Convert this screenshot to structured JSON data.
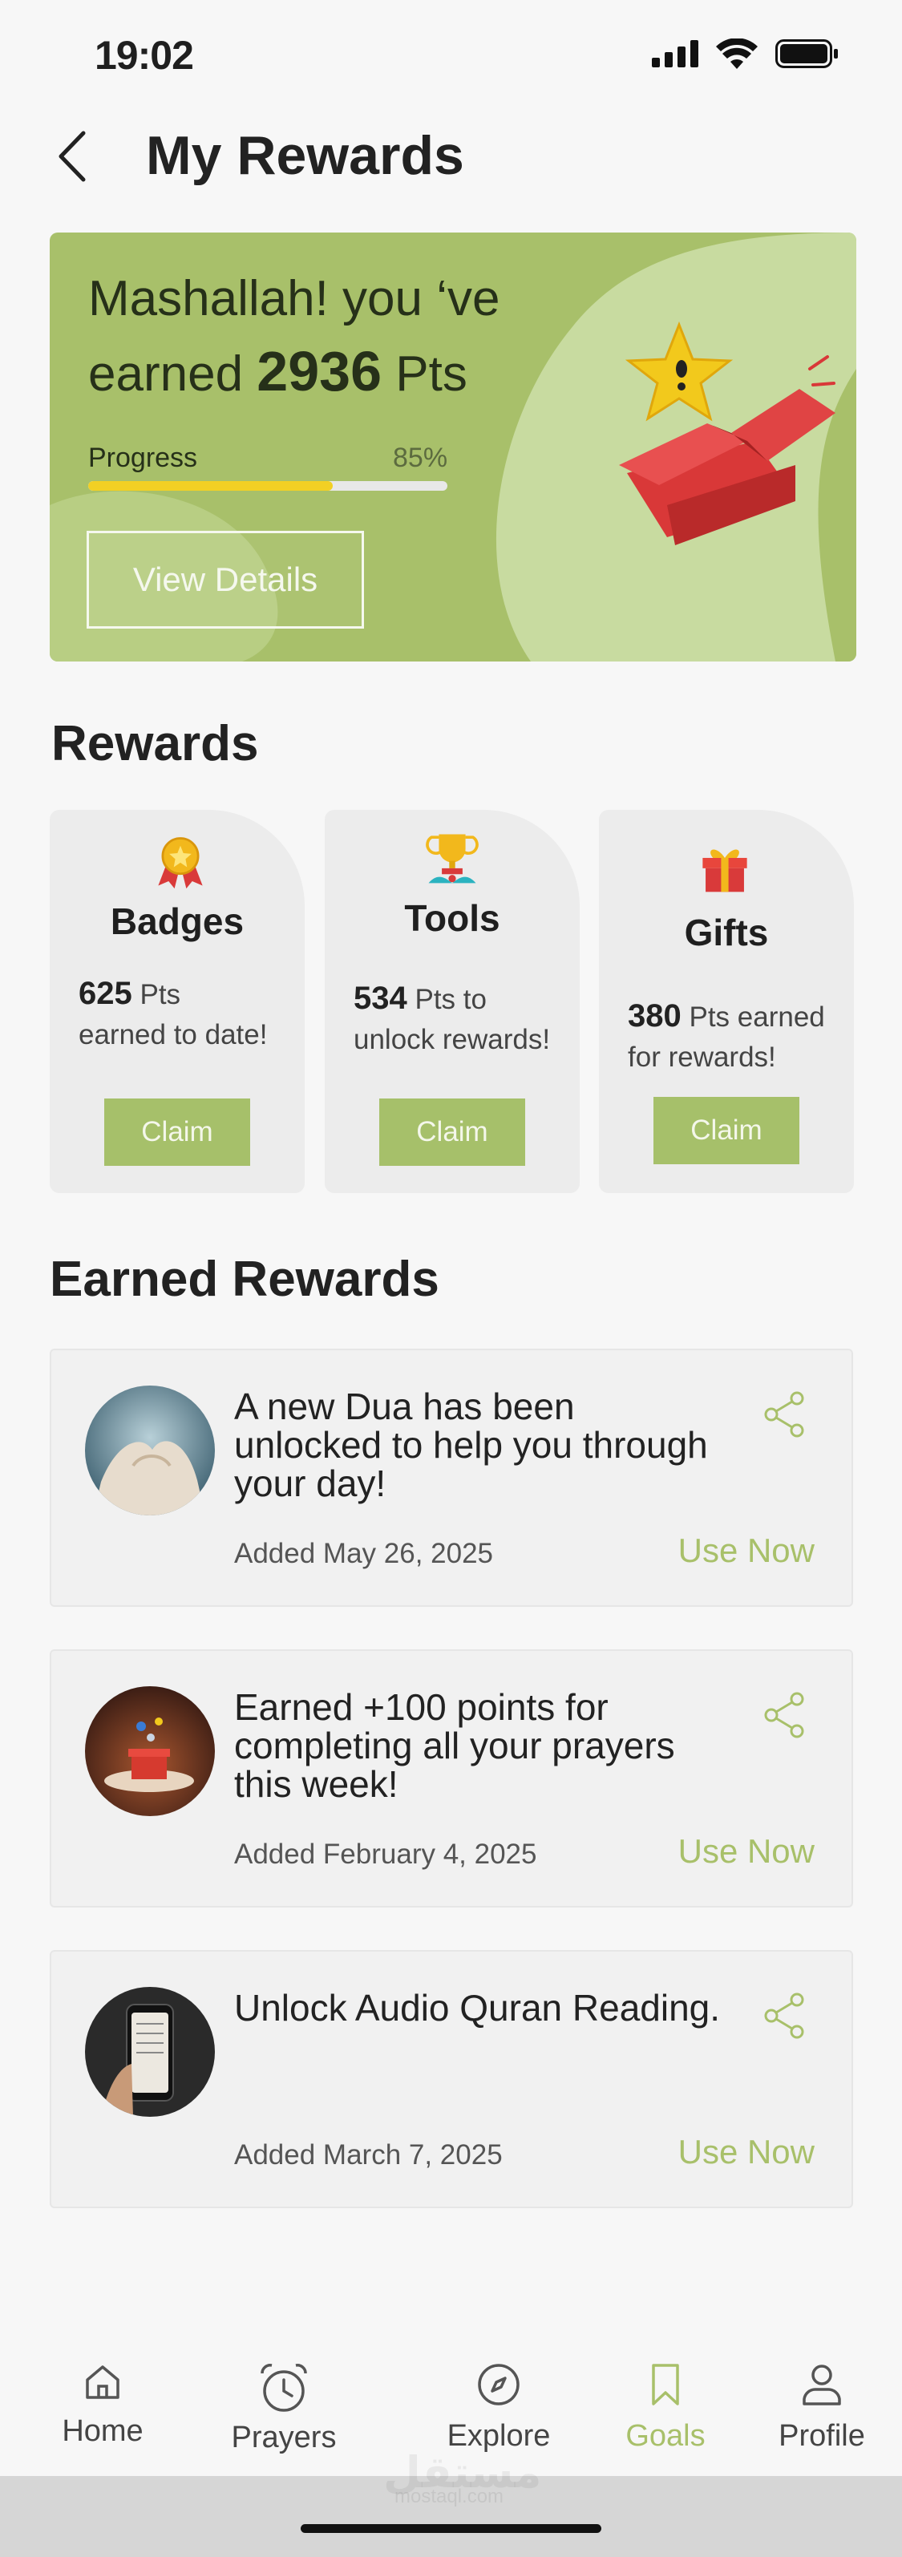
{
  "status_bar": {
    "time": "19:02"
  },
  "header": {
    "title": "My Rewards"
  },
  "hero": {
    "line1": "Mashallah! you ‘ve",
    "line2_prefix": "earned",
    "points": "2936",
    "line2_suffix": "Pts",
    "progress_label": "Progress",
    "progress_text": "85%",
    "progress_value": 0.68,
    "button_label": "View Details",
    "colors": {
      "card": "#a8c06a",
      "blob": "#c8dba0",
      "progress": "#f2d024"
    }
  },
  "rewards": {
    "title": "Rewards",
    "cards": [
      {
        "title": "Badges",
        "points": "625",
        "desc_line1": "Pts",
        "desc_line2": "earned to date!",
        "claim": "Claim",
        "icon": "medal-icon"
      },
      {
        "title": "Tools",
        "points": "534",
        "desc_line1": "Pts to",
        "desc_line2": "unlock rewards!",
        "claim": "Claim",
        "icon": "trophy-icon"
      },
      {
        "title": "Gifts",
        "points": "380",
        "desc_line1": "Pts earned",
        "desc_line2": "for rewards!",
        "claim": "Claim",
        "icon": "gift-icon"
      }
    ]
  },
  "earned": {
    "title": "Earned Rewards",
    "items": [
      {
        "text": "A new Dua has been unlocked to help you through your day!",
        "date": "Added May 26,  2025",
        "action": "Use Now"
      },
      {
        "text": "Earned +100 points for completing all your prayers this week!",
        "date": "Added February 4,  2025",
        "action": "Use Now"
      },
      {
        "text": "Unlock Audio Quran Reading.",
        "date": "Added March 7,  2025",
        "action": "Use Now"
      }
    ]
  },
  "nav": {
    "items": [
      {
        "label": "Home",
        "icon": "home-icon"
      },
      {
        "label": "Prayers",
        "icon": "alarm-clock-icon"
      },
      {
        "label": "Explore",
        "icon": "compass-icon"
      },
      {
        "label": "Goals",
        "icon": "bookmark-icon",
        "active": true
      },
      {
        "label": "Profile",
        "icon": "user-icon"
      }
    ]
  },
  "watermark": {
    "text": "مستقل",
    "sub": "mostaql.com"
  },
  "accent_color": "#a8c06a"
}
